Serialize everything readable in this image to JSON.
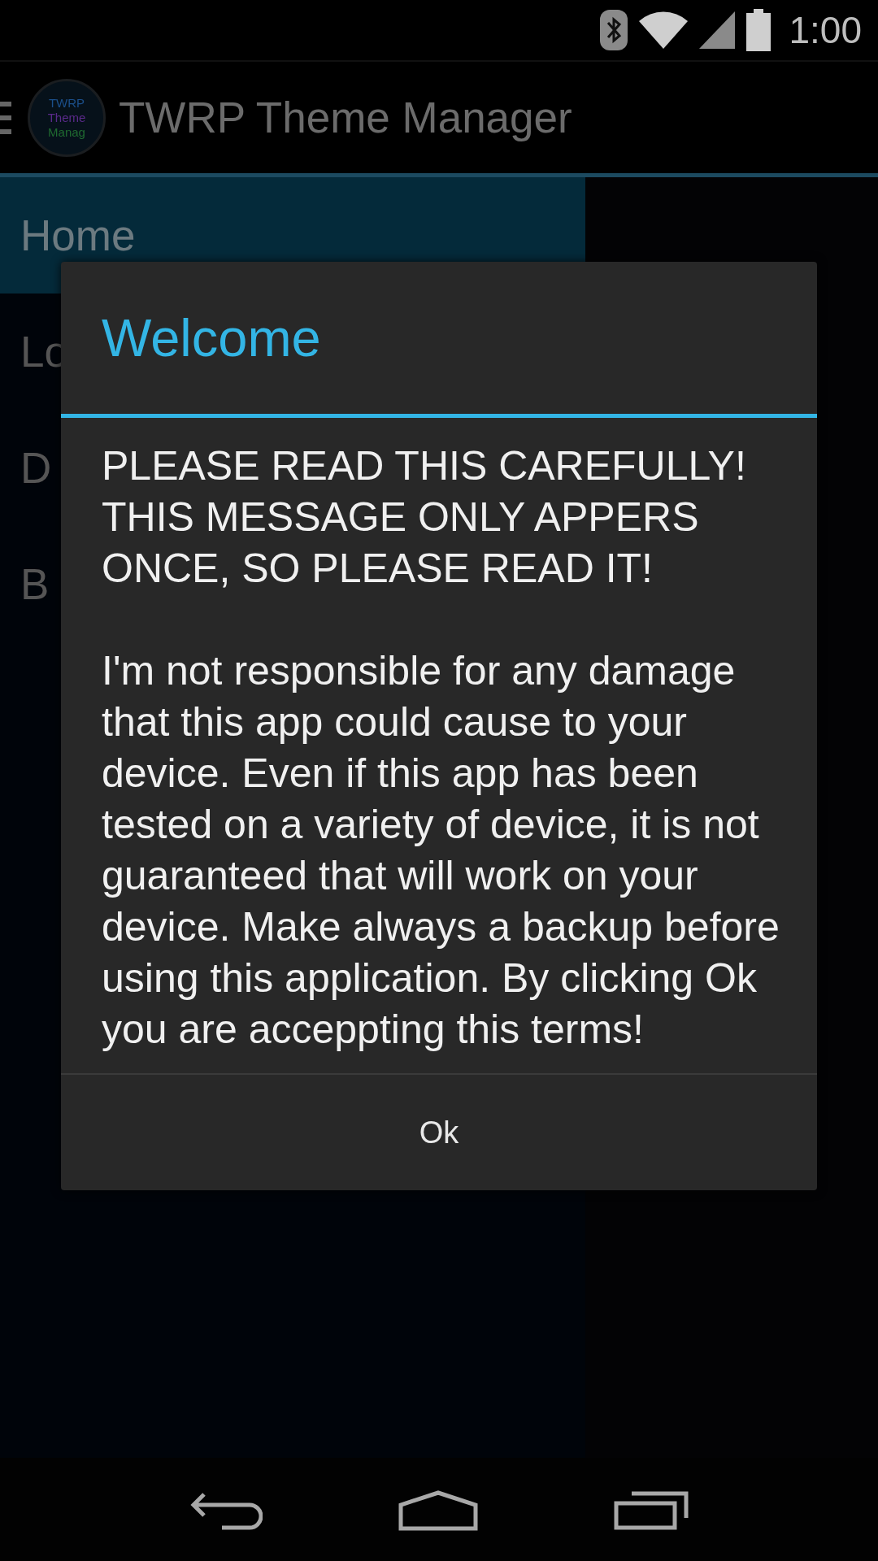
{
  "status_bar": {
    "time": "1:00"
  },
  "action_bar": {
    "title": "TWRP Theme Manager",
    "logo_lines": [
      "TWRP",
      "Theme",
      "Manag"
    ]
  },
  "drawer": {
    "items": [
      {
        "label": "Home",
        "selected": true
      },
      {
        "label": "Lo",
        "selected": false
      },
      {
        "label": "D",
        "selected": false
      },
      {
        "label": "B",
        "selected": false
      }
    ]
  },
  "dialog": {
    "title": "Welcome",
    "paragraphs": [
      "PLEASE READ THIS CAREFULLY! THIS MESSAGE ONLY APPERS ONCE, SO PLEASE READ IT!",
      "I'm not responsible for any damage that this app could cause to your device. Even if this app has been tested on a variety of device, it is not guaranteed that will work on your device. Make always a backup before using this application. By clicking Ok you are acceppting this terms!"
    ],
    "buttons": [
      "Ok"
    ]
  }
}
